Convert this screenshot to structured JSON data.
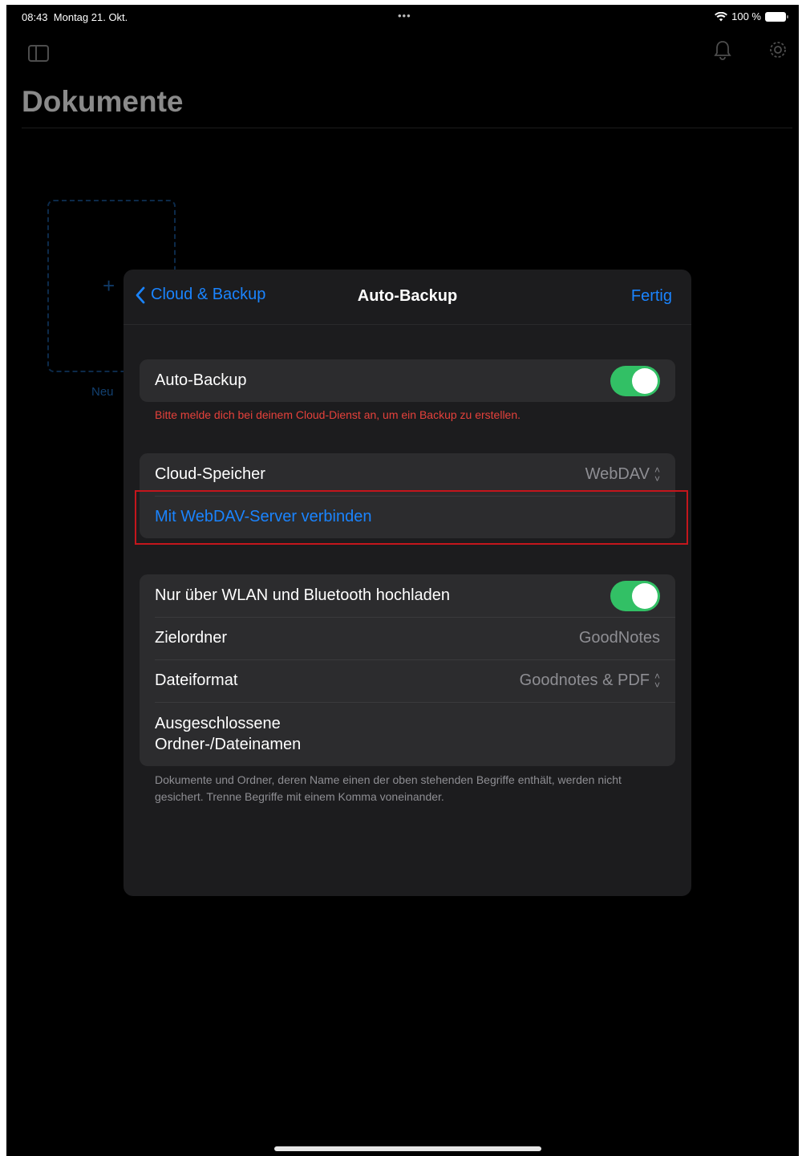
{
  "status_bar": {
    "time": "08:43",
    "date": "Montag 21. Okt.",
    "dots": "•••",
    "battery": "100 %",
    "wifi_icon": "wifi-icon"
  },
  "background": {
    "page_title": "Dokumente",
    "new_label": "Neu",
    "plus": "+",
    "bell_icon": "bell-icon",
    "gear_icon": "gear-icon",
    "sidebar_icon": "sidebar-icon"
  },
  "modal": {
    "back_label": "Cloud & Backup",
    "title": "Auto-Backup",
    "done_label": "Fertig",
    "auto_backup": {
      "label": "Auto-Backup",
      "enabled": true,
      "error": "Bitte melde dich bei deinem Cloud-Dienst an, um ein Backup zu erstellen."
    },
    "cloud": {
      "storage_label": "Cloud-Speicher",
      "storage_value": "WebDAV",
      "connect_label": "Mit WebDAV-Server verbinden"
    },
    "options": {
      "wifi_label": "Nur über WLAN und Bluetooth hochladen",
      "wifi_enabled": true,
      "folder_label": "Zielordner",
      "folder_value": "GoodNotes",
      "format_label": "Dateiformat",
      "format_value": "Goodnotes & PDF",
      "excluded_label_line1": "Ausgeschlossene",
      "excluded_label_line2": "Ordner-/Dateinamen"
    },
    "footer": "Dokumente und Ordner, deren Name einen der oben stehenden Begriffe enthält, werden nicht gesichert. Trenne Begriffe mit einem Komma voneinander."
  },
  "colors": {
    "accent": "#1a84ff",
    "toggle_on": "#32c065",
    "error": "#e5413b",
    "highlight": "#c4161c"
  }
}
